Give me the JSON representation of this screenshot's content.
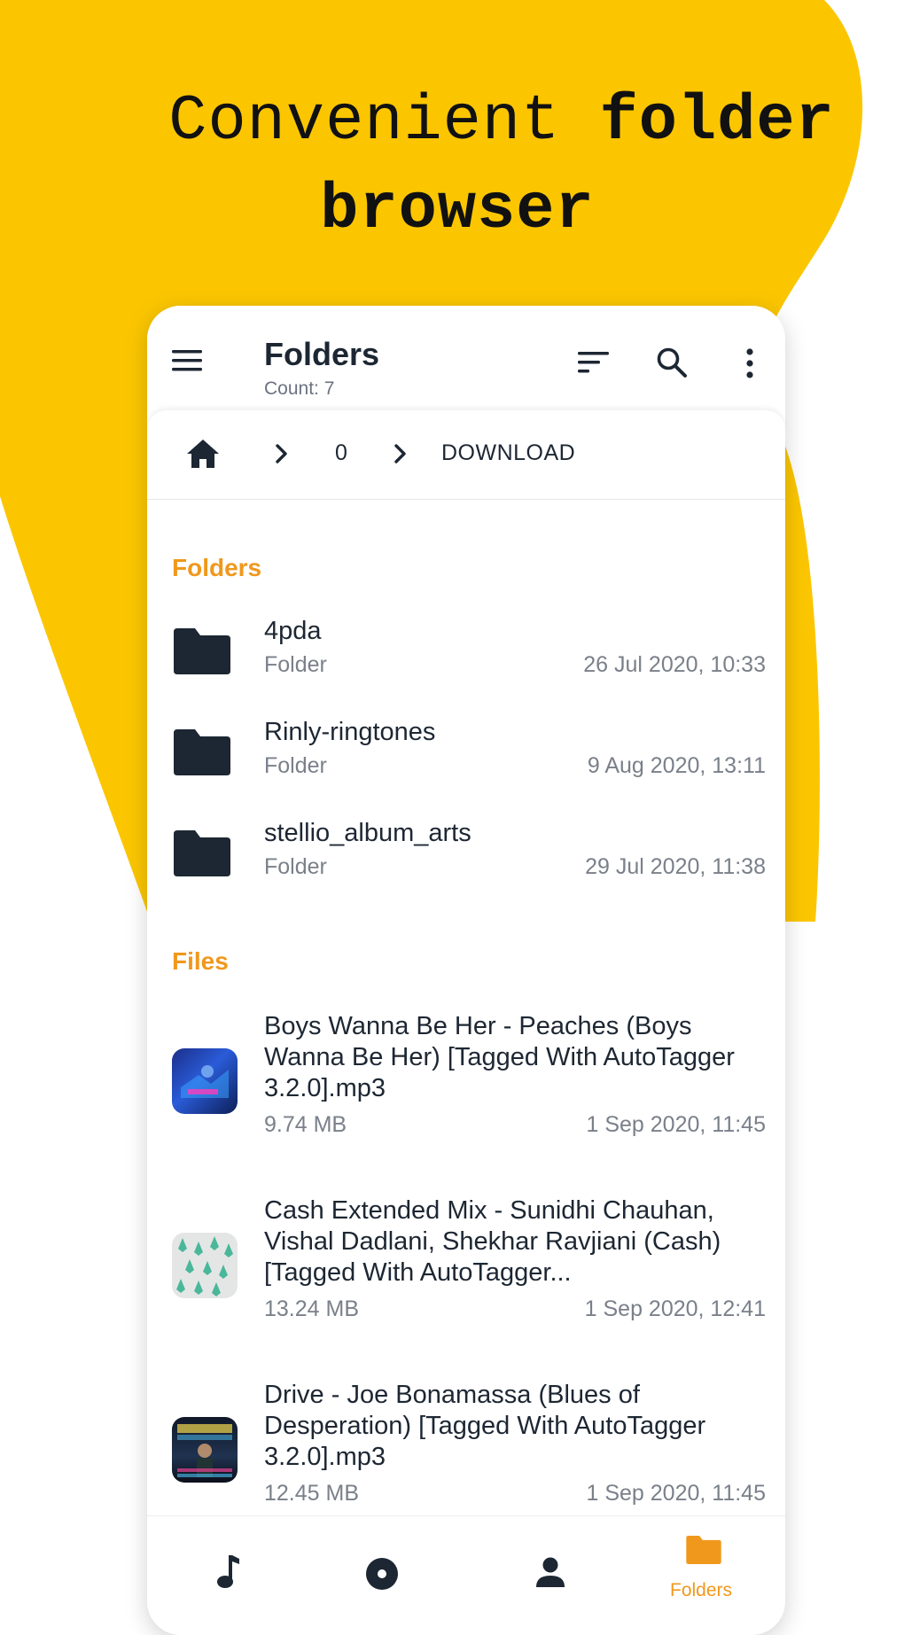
{
  "headline": {
    "line1_light": "Convenient ",
    "line1_bold": "folder",
    "line2": "browser"
  },
  "appbar": {
    "title": "Folders",
    "subtitle": "Count: 7"
  },
  "breadcrumb": {
    "items": [
      "0",
      "DOWNLOAD"
    ]
  },
  "sections": {
    "folders": "Folders",
    "files": "Files"
  },
  "folders": [
    {
      "name": "4pda",
      "type": "Folder",
      "date": "26 Jul 2020, 10:33"
    },
    {
      "name": "Rinly-ringtones",
      "type": "Folder",
      "date": "9 Aug 2020, 13:11"
    },
    {
      "name": "stellio_album_arts",
      "type": "Folder",
      "date": "29 Jul 2020, 11:38"
    }
  ],
  "files": [
    {
      "name": "Boys Wanna Be Her - Peaches (Boys Wanna Be Her) [Tagged With AutoTagger 3.2.0].mp3",
      "size": "9.74 MB",
      "date": "1 Sep 2020, 11:45"
    },
    {
      "name": "Cash Extended Mix - Sunidhi Chauhan, Vishal Dadlani, Shekhar Ravjiani (Cash) [Tagged With AutoTagger...",
      "size": "13.24 MB",
      "date": "1 Sep 2020, 12:41"
    },
    {
      "name": "Drive - Joe Bonamassa (Blues of Desperation) [Tagged With AutoTagger 3.2.0].mp3",
      "size": "12.45 MB",
      "date": "1 Sep 2020, 11:45"
    }
  ],
  "bottom_nav": {
    "active_label": "Folders"
  },
  "colors": {
    "accent": "#f0981c",
    "background_blob": "#fbc600",
    "text_dark": "#1d2733"
  },
  "icons": [
    "menu-icon",
    "sort-icon",
    "search-icon",
    "more-vert-icon",
    "home-icon",
    "chevron-right-icon",
    "folder-icon",
    "music-note-icon",
    "disc-icon",
    "person-icon"
  ]
}
